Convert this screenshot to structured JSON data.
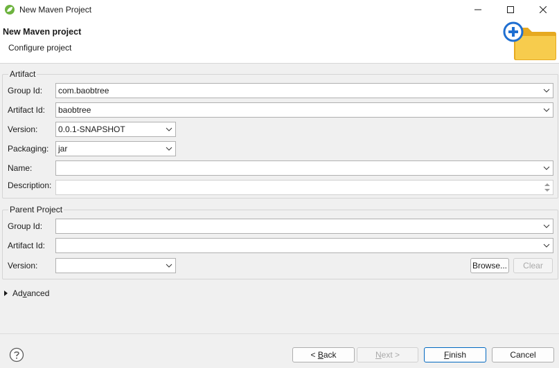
{
  "window": {
    "title": "New Maven Project"
  },
  "banner": {
    "title": "New Maven project",
    "subtitle": "Configure project"
  },
  "artifact": {
    "legend": "Artifact",
    "group_id_label": "Group Id:",
    "group_id_value": "com.baobtree",
    "artifact_id_label": "Artifact Id:",
    "artifact_id_value": "baobtree",
    "version_label": "Version:",
    "version_value": "0.0.1-SNAPSHOT",
    "packaging_label": "Packaging:",
    "packaging_value": "jar",
    "name_label": "Name:",
    "name_value": "",
    "description_label": "Description:",
    "description_value": ""
  },
  "parent": {
    "legend": "Parent Project",
    "group_id_label": "Group Id:",
    "group_id_value": "",
    "artifact_id_label": "Artifact Id:",
    "artifact_id_value": "",
    "version_label": "Version:",
    "version_value": "",
    "browse_label": "Browse...",
    "clear_label": "Clear"
  },
  "advanced": {
    "label_prefix": "Ad",
    "label_mnemonic": "v",
    "label_suffix": "anced"
  },
  "buttons": {
    "back_prefix": "< ",
    "back_mnemonic": "B",
    "back_suffix": "ack",
    "next_mnemonic": "N",
    "next_suffix": "ext >",
    "finish_mnemonic": "F",
    "finish_suffix": "inish",
    "cancel_label": "Cancel"
  },
  "icons": {
    "app": "spring-leaf-icon",
    "minimize": "minimize-icon",
    "maximize": "maximize-icon",
    "close": "close-icon",
    "banner": "new-folder-plus-icon",
    "help": "help-icon",
    "dropdown": "chevron-down-icon"
  },
  "colors": {
    "primary_border": "#0067c0",
    "folder": "#f5c342",
    "plus": "#1f6fd1"
  }
}
